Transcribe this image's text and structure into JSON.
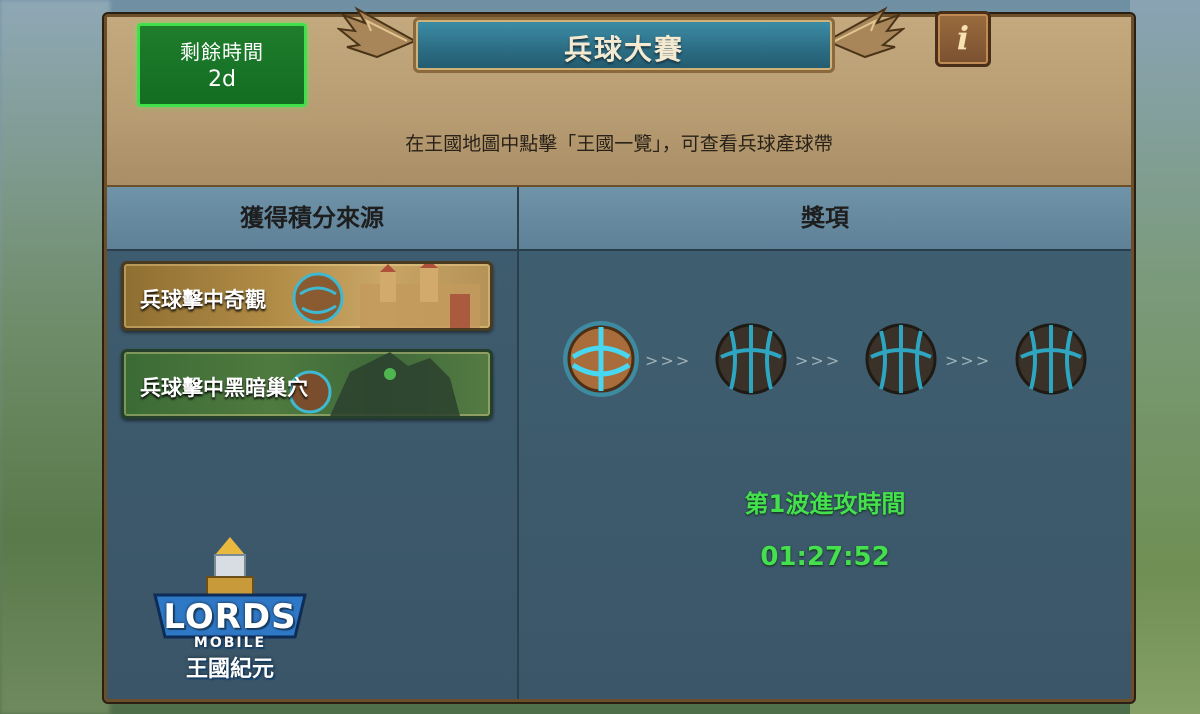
{
  "header": {
    "title": "兵球大賽",
    "info_icon": "i",
    "timer_label": "剩餘時間",
    "timer_value": "2d",
    "hint": "在王國地圖中點擊「王國一覽」，可查看兵球產球帶"
  },
  "points_panel": {
    "title": "獲得積分來源",
    "sources": [
      {
        "label": "兵球擊中奇觀",
        "icon": "castle-icon"
      },
      {
        "label": "兵球擊中黑暗巢穴",
        "icon": "dark-nest-icon"
      }
    ]
  },
  "rewards_panel": {
    "title": "獎項",
    "balls": [
      {
        "state": "active"
      },
      {
        "state": "locked"
      },
      {
        "state": "locked"
      },
      {
        "state": "locked"
      }
    ],
    "wave_label": "第1波進攻時間",
    "wave_timer": "01:27:52"
  },
  "logo": {
    "line1": "LORDS",
    "line2": "MOBILE",
    "line3": "王國紀元"
  },
  "colors": {
    "timer_green": "#3fe04a",
    "countdown_green": "#45e04e",
    "frame_brown": "#6b4f2a",
    "panel_blue": "#3b5668"
  }
}
